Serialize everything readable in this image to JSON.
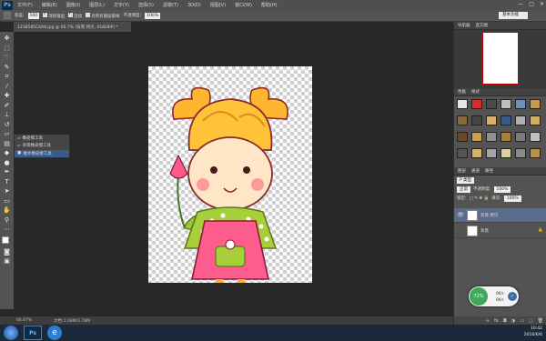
{
  "app": {
    "logo": "Ps"
  },
  "menu": [
    "文件(F)",
    "编辑(E)",
    "图像(I)",
    "图层(L)",
    "文字(Y)",
    "选择(S)",
    "滤镜(T)",
    "3D(D)",
    "视图(V)",
    "窗口(W)",
    "帮助(H)"
  ],
  "window_controls": [
    "—",
    "□",
    "✕"
  ],
  "options_bar": {
    "tolerance_label": "容差:",
    "tolerance_value": "100",
    "antialias_label": "消除锯齿",
    "contiguous_label": "连续",
    "all_layers_label": "对所有图层取样",
    "opacity_label": "不透明度:",
    "opacity_value": "100%",
    "workspace": "基本功能"
  },
  "document": {
    "tab_label": "1238585C6A8.jpg @ 66.7% (背景 拷贝, RGB/8#) *",
    "zoom": "66.67%",
    "doc_info": "文档:1.68M/3.78M"
  },
  "eraser_flyout": [
    "橡皮擦工具",
    "背景橡皮擦工具",
    "魔术橡皮擦工具"
  ],
  "panels": {
    "navigator_tabs": [
      "导航器",
      "直方图"
    ],
    "style_tabs": [
      "色板",
      "样式"
    ],
    "layers_tabs": [
      "图层",
      "通道",
      "路径"
    ],
    "kind_label": "P 类型",
    "blend_mode": "正常",
    "opacity_label": "不透明度:",
    "opacity_value": "100%",
    "lock_label": "锁定:",
    "fill_label": "填充:",
    "fill_value": "100%"
  },
  "layers": [
    {
      "name": "背景 拷贝",
      "visible": true
    },
    {
      "name": "背景",
      "visible": false
    }
  ],
  "styles_colors": [
    "#e8e8e8",
    "#d03030",
    "#4a4a4a",
    "#bdbdbd",
    "#6d8fb8",
    "#c99a4a",
    "#8a6a3a",
    "#444444",
    "#d8b070",
    "#3a5a8a",
    "#b0b0b0",
    "#d0b060",
    "#6a4a2a",
    "#c8a050",
    "#909090",
    "#a87f3a",
    "#7a7a7a",
    "#c0c0c0",
    "#555555",
    "#d4b468",
    "#a4a4a4",
    "#e0d0a0",
    "#8a8a8a",
    "#b89050"
  ],
  "widget": {
    "percent": "72%",
    "up": "0K/s",
    "down": "0K/s"
  },
  "taskbar": {
    "time": "10:42",
    "date": "2016/6/6"
  }
}
